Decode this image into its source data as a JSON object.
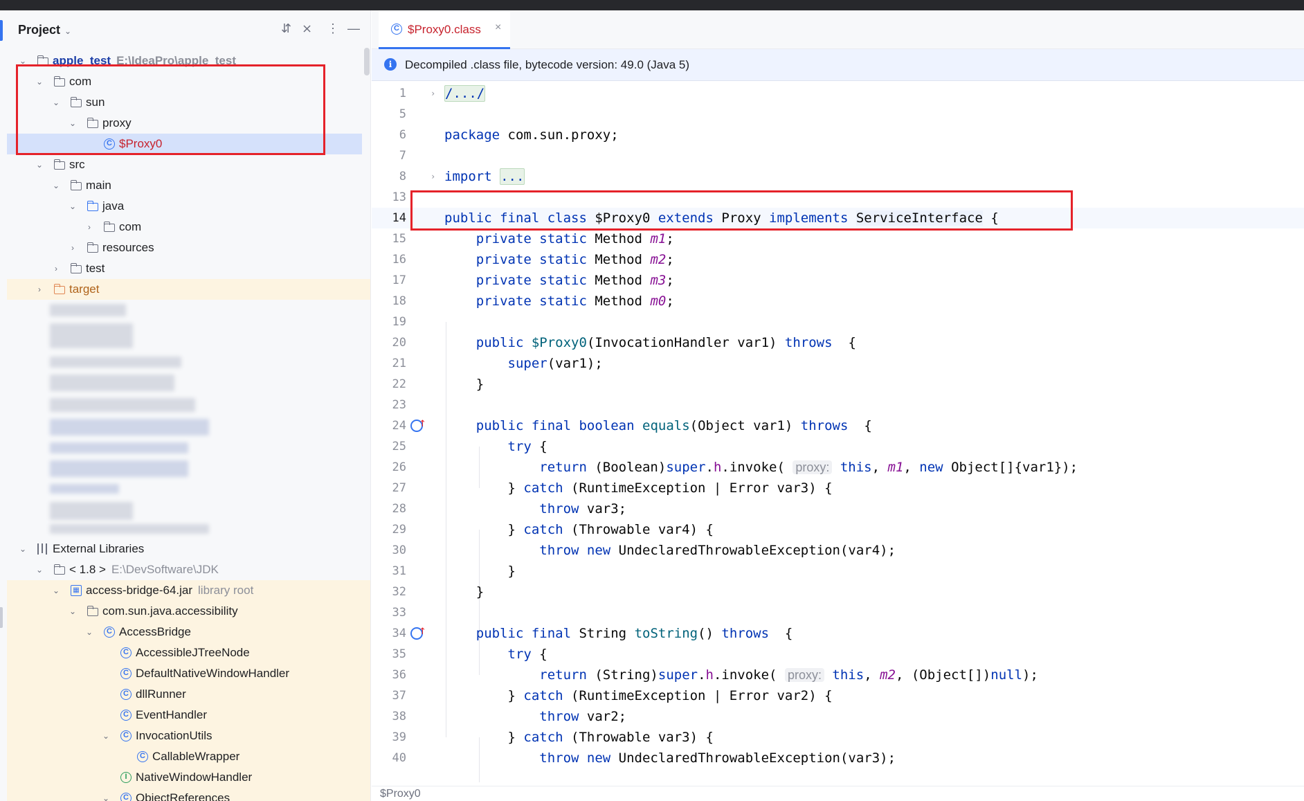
{
  "project_panel": {
    "title": "Project",
    "tree": {
      "root_label": "apple_test",
      "root_path": "E:\\IdeaPro\\apple_test",
      "com": "com",
      "sun": "sun",
      "proxy": "proxy",
      "proxy_class": "$Proxy0",
      "src": "src",
      "main": "main",
      "java": "java",
      "pkg_com": "com",
      "resources": "resources",
      "test": "test",
      "target": "target",
      "external_libraries": "External Libraries",
      "jdk_label": "< 1.8 >",
      "jdk_path": "E:\\DevSoftware\\JDK",
      "jar": "access-bridge-64.jar",
      "jar_note": "library root",
      "accessibility_pkg": "com.sun.java.accessibility",
      "access_bridge": "AccessBridge",
      "accessible_jtree_node": "AccessibleJTreeNode",
      "default_native_window_handler": "DefaultNativeWindowHandler",
      "dll_runner": "dllRunner",
      "event_handler": "EventHandler",
      "invocation_utils": "InvocationUtils",
      "callable_wrapper": "CallableWrapper",
      "native_window_handler": "NativeWindowHandler",
      "object_references": "ObjectReferences"
    }
  },
  "editor": {
    "tab_label": "$Proxy0.class",
    "banner_text": "Decompiled .class file, bytecode version: 49.0 (Java 5)",
    "status_text": "$Proxy0",
    "line_numbers": [
      "1",
      "5",
      "6",
      "7",
      "8",
      "13",
      "14",
      "15",
      "16",
      "17",
      "18",
      "19",
      "20",
      "21",
      "22",
      "23",
      "24",
      "25",
      "26",
      "27",
      "28",
      "29",
      "30",
      "31",
      "32",
      "33",
      "34",
      "35",
      "36",
      "37",
      "38",
      "39",
      "40"
    ],
    "hints": {
      "proxy": "proxy:"
    },
    "fold_placeholder": "...",
    "header_fold": "/.../"
  },
  "colors": {
    "accent": "#3574f0",
    "highlight_box": "#e5222a",
    "keyword": "#0033b3",
    "field": "#871094",
    "excluded_folder_bg": "#fdf4e1"
  }
}
